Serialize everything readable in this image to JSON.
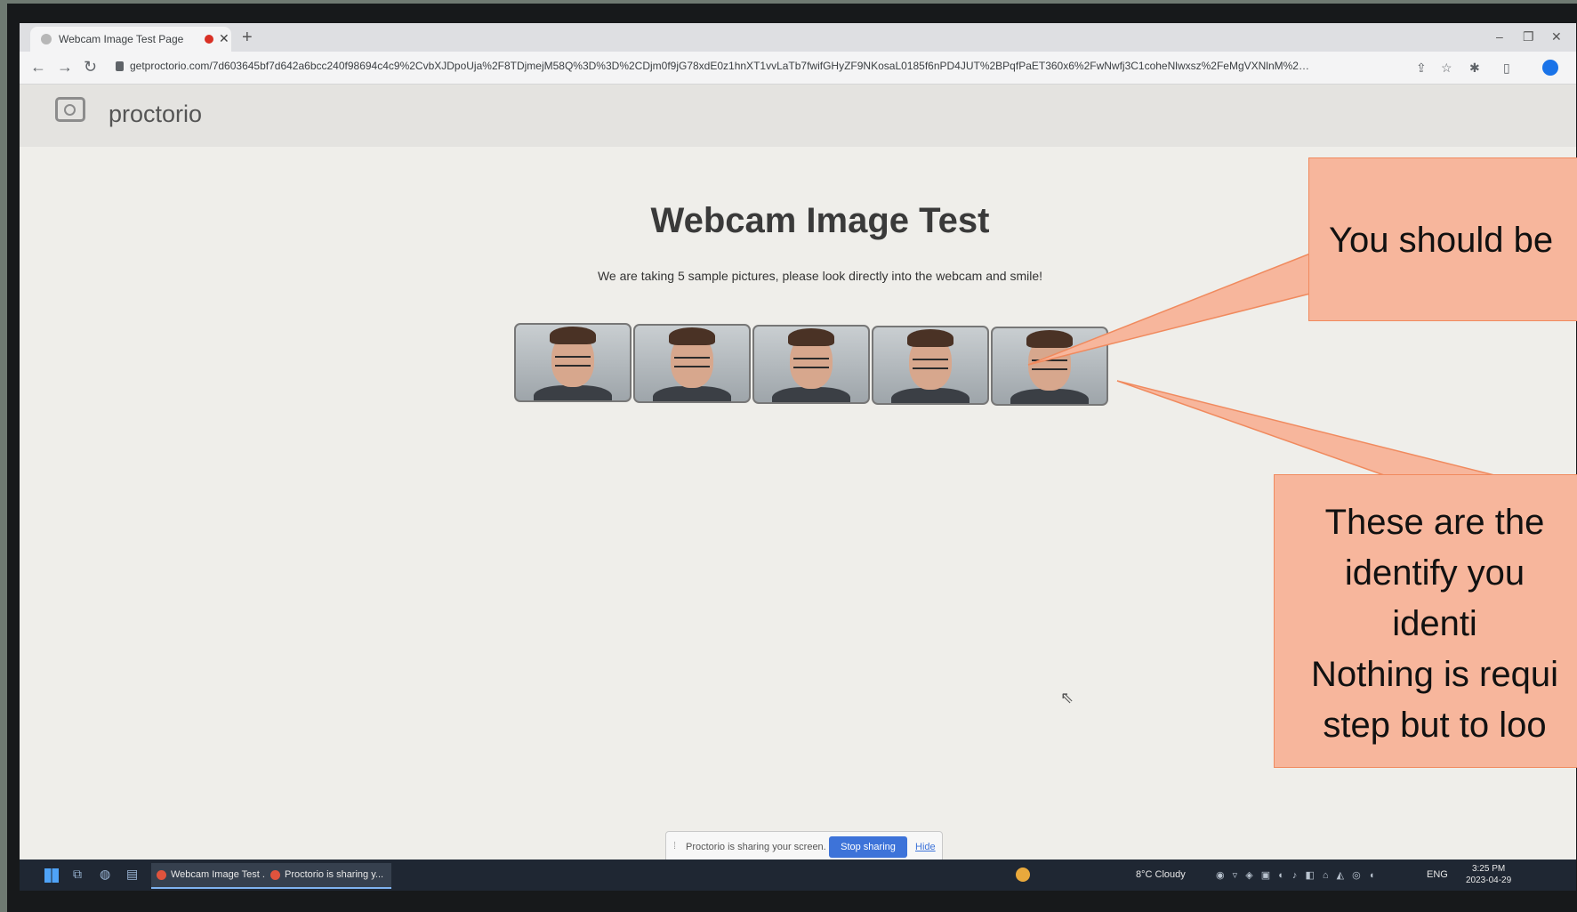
{
  "browser": {
    "tab_title": "Webcam Image Test Page",
    "new_tab": "+",
    "url": "getproctorio.com/7d603645bf7d642a6bcc240f98694c4c9%2CvbXJDpoUja%2F8TDjmejM58Q%3D%3D%2CDjm0f9jG78xdE0z1hnXT1vvLaTb7fwifGHyZF9NKosaL0185f6nPD4JUT%2BPqfPaET360x6%2FwNwfj3C1coheNlwxsz%2FeMgVXNlnM%281zHx..."
  },
  "page": {
    "logo_text": "proctorio",
    "title": "Webcam Image Test",
    "instructions": "We are taking 5 sample pictures, please look directly into the webcam and smile!",
    "sample_count": 5
  },
  "share_bar": {
    "message": "Proctorio is sharing your screen.",
    "stop_label": "Stop sharing",
    "hide_label": "Hide"
  },
  "taskbar": {
    "task_1": "Webcam Image Test ...",
    "task_2": "Proctorio is sharing y...",
    "weather": "8°C  Cloudy",
    "lang": "ENG",
    "time": "3:25 PM",
    "date": "2023-04-29"
  },
  "callouts": {
    "top": "You should be",
    "bottom": "These are the\nidentify you\nidenti\nNothing is requi\nstep but to loo"
  },
  "colors": {
    "callout_fill": "#f7b69c",
    "callout_border": "#f08a5e",
    "stop_button": "#3d73d9"
  }
}
